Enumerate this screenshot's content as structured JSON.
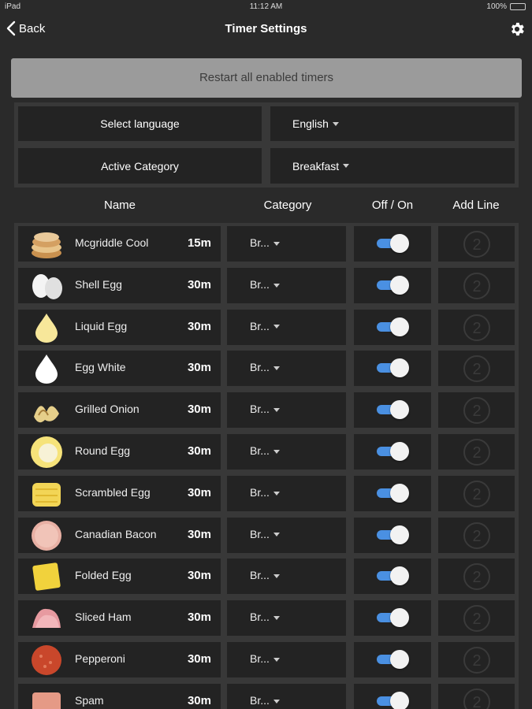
{
  "status": {
    "carrier": "iPad",
    "time": "11:12 AM",
    "battery": "100%"
  },
  "nav": {
    "back_label": "Back",
    "title": "Timer Settings"
  },
  "restart_label": "Restart all enabled timers",
  "settings": {
    "language_label": "Select language",
    "language_value": "English",
    "category_label": "Active Category",
    "category_value": "Breakfast"
  },
  "columns": {
    "name": "Name",
    "category": "Category",
    "toggle": "Off / On",
    "add_line": "Add Line"
  },
  "colors": {
    "accent": "#4a90e2",
    "background": "#2a2a2a",
    "cell": "#232323",
    "border": "#383838",
    "restart_button": "#9b9b9b"
  },
  "timers": [
    {
      "name": "Mcgriddle Cool",
      "duration": "15m",
      "category": "Br...",
      "enabled": true,
      "icon": "mcgriddle-icon"
    },
    {
      "name": "Shell Egg",
      "duration": "30m",
      "category": "Br...",
      "enabled": true,
      "icon": "shell-egg-icon"
    },
    {
      "name": "Liquid Egg",
      "duration": "30m",
      "category": "Br...",
      "enabled": true,
      "icon": "liquid-egg-icon"
    },
    {
      "name": "Egg White",
      "duration": "30m",
      "category": "Br...",
      "enabled": true,
      "icon": "egg-white-icon"
    },
    {
      "name": "Grilled Onion",
      "duration": "30m",
      "category": "Br...",
      "enabled": true,
      "icon": "grilled-onion-icon"
    },
    {
      "name": "Round Egg",
      "duration": "30m",
      "category": "Br...",
      "enabled": true,
      "icon": "round-egg-icon"
    },
    {
      "name": "Scrambled Egg",
      "duration": "30m",
      "category": "Br...",
      "enabled": true,
      "icon": "scrambled-egg-icon"
    },
    {
      "name": "Canadian Bacon",
      "duration": "30m",
      "category": "Br...",
      "enabled": true,
      "icon": "canadian-bacon-icon"
    },
    {
      "name": "Folded Egg",
      "duration": "30m",
      "category": "Br...",
      "enabled": true,
      "icon": "folded-egg-icon"
    },
    {
      "name": "Sliced Ham",
      "duration": "30m",
      "category": "Br...",
      "enabled": true,
      "icon": "sliced-ham-icon"
    },
    {
      "name": "Pepperoni",
      "duration": "30m",
      "category": "Br...",
      "enabled": true,
      "icon": "pepperoni-icon"
    },
    {
      "name": "Spam",
      "duration": "30m",
      "category": "Br...",
      "enabled": true,
      "icon": "spam-icon"
    }
  ],
  "add_line_digit": "2"
}
